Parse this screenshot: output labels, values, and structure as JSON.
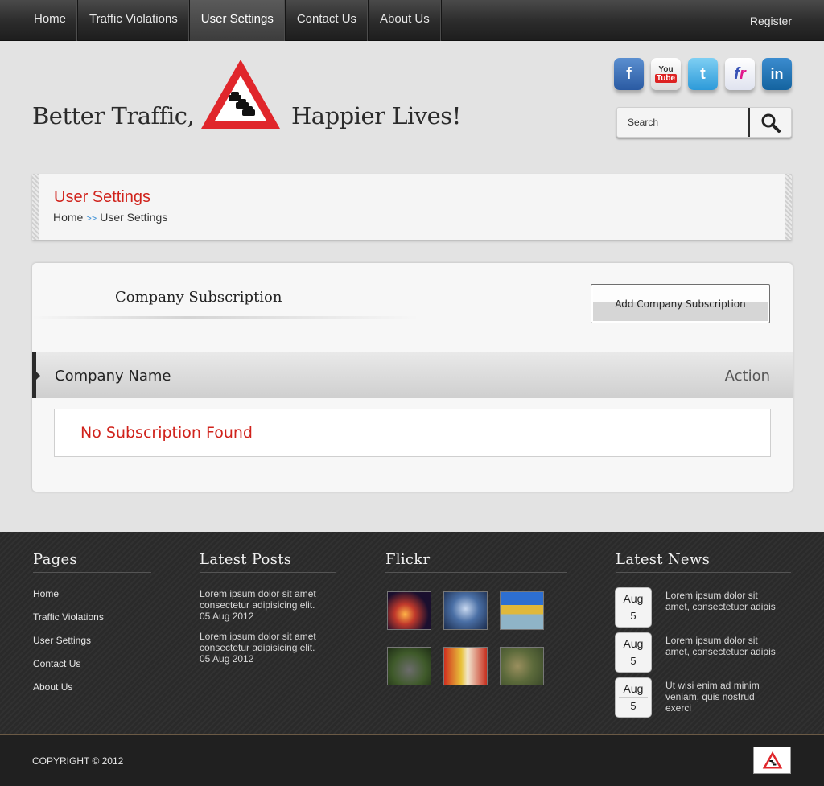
{
  "nav": {
    "items": [
      {
        "label": "Home",
        "active": false
      },
      {
        "label": "Traffic Violations",
        "active": false
      },
      {
        "label": "User Settings",
        "active": true
      },
      {
        "label": "Contact Us",
        "active": false
      },
      {
        "label": "About Us",
        "active": false
      }
    ],
    "register": "Register"
  },
  "header": {
    "slogan_left": "Better Traffic,",
    "slogan_right": "Happier Lives!",
    "social": [
      "facebook-icon",
      "youtube-icon",
      "twitter-icon",
      "flickr-icon",
      "linkedin-icon"
    ],
    "search_placeholder": "Search"
  },
  "titlebar": {
    "title": "User Settings",
    "crumbs": [
      "Home",
      ">>",
      "User Settings"
    ]
  },
  "card": {
    "title": "Company Subscription",
    "add_button": "Add Company Subscription",
    "columns": [
      "Company Name",
      "Action"
    ],
    "empty_message": "No Subscription Found"
  },
  "footer": {
    "pages": {
      "heading": "Pages",
      "links": [
        "Home",
        "Traffic Violations",
        "User Settings",
        "Contact Us",
        "About Us"
      ]
    },
    "posts": {
      "heading": "Latest Posts",
      "items": [
        {
          "line1": "Lorem ipsum dolor sit amet",
          "line2": "consectetur adipisicing elit.",
          "date": "05 Aug 2012"
        },
        {
          "line1": "Lorem ipsum dolor sit amet",
          "line2": "consectetur adipisicing elit.",
          "date": "05 Aug 2012"
        }
      ]
    },
    "flickr": {
      "heading": "Flickr"
    },
    "news": {
      "heading": "Latest News",
      "items": [
        {
          "month": "Aug",
          "day": "5",
          "text": "Lorem ipsum dolor sit amet, consectetuer adipis"
        },
        {
          "month": "Aug",
          "day": "5",
          "text": "Lorem ipsum dolor sit amet, consectetuer adipis"
        },
        {
          "month": "Aug",
          "day": "5",
          "text": "Ut wisi enim ad minim veniam, quis nostrud exerci"
        }
      ]
    },
    "copyright": "COPYRIGHT © 2012"
  },
  "colors": {
    "accent_red": "#d0221b",
    "nav_bg": "#2b2b2b",
    "link_blue": "#3a8fd6"
  }
}
